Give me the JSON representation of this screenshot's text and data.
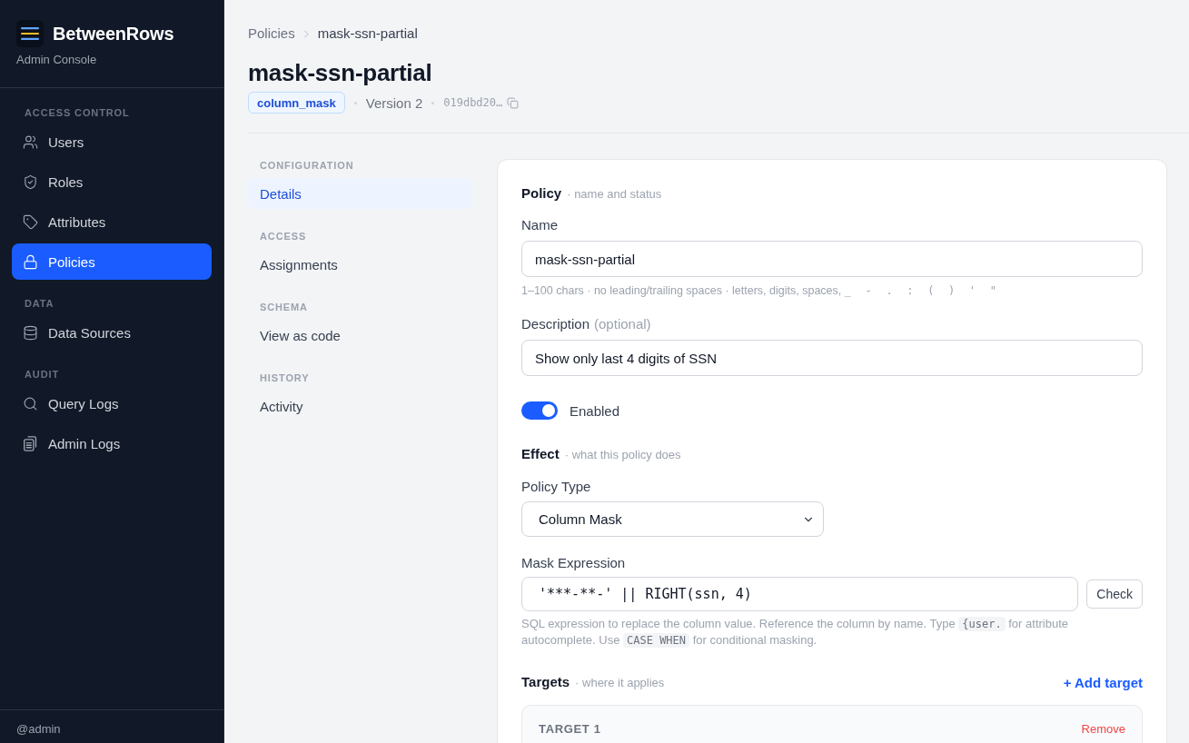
{
  "sidebar": {
    "brand": {
      "title": "BetweenRows",
      "subtitle": "Admin Console"
    },
    "sections": [
      {
        "heading": "ACCESS CONTROL",
        "items": [
          {
            "label": "Users",
            "selected": false
          },
          {
            "label": "Roles",
            "selected": false
          },
          {
            "label": "Attributes",
            "selected": false
          },
          {
            "label": "Policies",
            "selected": true
          }
        ]
      },
      {
        "heading": "DATA",
        "items": [
          {
            "label": "Data Sources",
            "selected": false
          }
        ]
      },
      {
        "heading": "AUDIT",
        "items": [
          {
            "label": "Query Logs",
            "selected": false
          },
          {
            "label": "Admin Logs",
            "selected": false
          }
        ]
      }
    ],
    "user": "@admin"
  },
  "breadcrumb": [
    "Policies",
    "mask-ssn-partial"
  ],
  "header": {
    "title": "mask-ssn-partial",
    "badge": "column_mask",
    "version": "Version 2",
    "id": "019dbd20…"
  },
  "subnav": [
    {
      "heading": "CONFIGURATION",
      "items": [
        {
          "label": "Details",
          "selected": true
        }
      ]
    },
    {
      "heading": "ACCESS",
      "items": [
        {
          "label": "Assignments",
          "selected": false
        }
      ]
    },
    {
      "heading": "SCHEMA",
      "items": [
        {
          "label": "View as code",
          "selected": false
        }
      ]
    },
    {
      "heading": "HISTORY",
      "items": [
        {
          "label": "Activity",
          "selected": false
        }
      ]
    }
  ],
  "policy": {
    "title": "Policy",
    "subtitle": "· name and status",
    "name": {
      "label": "Name",
      "value": "mask-ssn-partial",
      "hint": [
        {
          "kind": "text",
          "text": "1–100 chars · no leading/trailing spaces · letters, digits, spaces, "
        },
        {
          "kind": "mono",
          "text": "_ - . : ( ) ' \""
        }
      ]
    },
    "description": {
      "label": "Description",
      "note": "(optional)",
      "value": "Show only last 4 digits of SSN"
    },
    "enabled": {
      "label": "Enabled",
      "on": true
    }
  },
  "effect": {
    "title": "Effect",
    "subtitle": "· what this policy does",
    "policy_type": {
      "label": "Policy Type",
      "value": "Column Mask"
    },
    "mask_expression": {
      "label": "Mask Expression",
      "value": "'***-**-' || RIGHT(ssn, 4)",
      "button": "Check",
      "hint": [
        {
          "kind": "text",
          "text": "SQL expression to replace the column value. Reference the column by name. Type "
        },
        {
          "kind": "code",
          "text": "{user."
        },
        {
          "kind": "text",
          "text": " for attribute autocomplete. Use "
        },
        {
          "kind": "code",
          "text": "CASE WHEN"
        },
        {
          "kind": "text",
          "text": " for conditional masking."
        }
      ]
    }
  },
  "targets": {
    "title": "Targets",
    "subtitle": "· where it applies",
    "add": "+ Add target",
    "items": [
      {
        "title": "TARGET 1",
        "remove": "Remove"
      }
    ]
  }
}
